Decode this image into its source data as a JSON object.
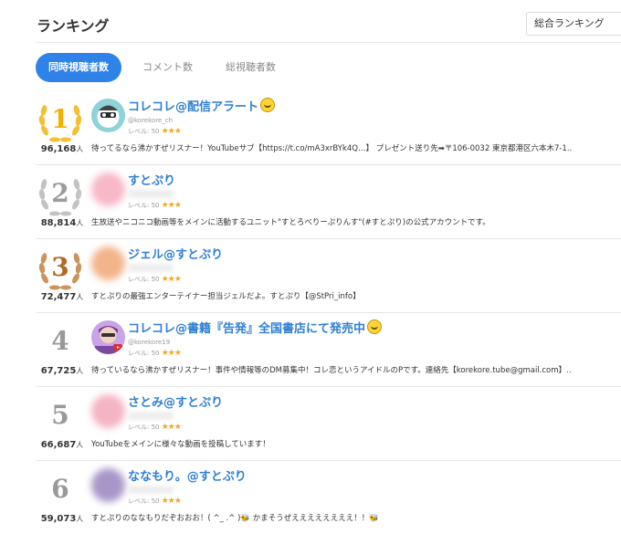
{
  "page": {
    "title": "ランキング"
  },
  "select": {
    "value": "総合ランキング"
  },
  "tabs": [
    {
      "label": "同時視聴者数",
      "active": true
    },
    {
      "label": "コメント数",
      "active": false
    },
    {
      "label": "総視聴者数",
      "active": false
    }
  ],
  "colors": {
    "accent": "#2e82e8",
    "name": "#2f7fd4",
    "star": "#f5a623",
    "gold": "#f5b000",
    "silver": "#9c9c9c",
    "bronze": "#b06a25"
  },
  "rows": [
    {
      "rank": "1",
      "viewers": "96,168",
      "unit": "人",
      "name": "コレコレ@配信アラート",
      "handle": "@korekore_ch",
      "level_label": "レベル: 50",
      "stars": "★★★",
      "desc": "待ってるなら沸かすぜリスナー！YouTubeサブ【https://t.co/mA3xrBYk4Q…】 プレゼント送り先➡〒106-0032 東京都港区六本木7-1.."
    },
    {
      "rank": "2",
      "viewers": "88,814",
      "unit": "人",
      "name": "すとぷり",
      "handle": "",
      "level_label": "レベル: 50",
      "stars": "★★★",
      "desc": "生放送やニコニコ動画等をメインに活動するユニット\"すとろべりーぷりんす\"(#すとぷり)の公式アカウントです。"
    },
    {
      "rank": "3",
      "viewers": "72,477",
      "unit": "人",
      "name": "ジェル@すとぷり",
      "handle": "",
      "level_label": "レベル: 50",
      "stars": "★★★",
      "desc": "すとぷりの最強エンターテイナー担当ジェルだよ。すとぷり【@StPri_info】"
    },
    {
      "rank": "4",
      "viewers": "67,725",
      "unit": "人",
      "name": "コレコレ@書籍『告発』全国書店にて発売中",
      "handle": "@korekore19",
      "level_label": "レベル: 50",
      "stars": "★★★",
      "desc": "待っているなら沸かすぜリスナー！事件や情報等のDM募集中！コレ恋というアイドルのPです。連絡先【korekore.tube@gmail.com】.."
    },
    {
      "rank": "5",
      "viewers": "66,687",
      "unit": "人",
      "name": "さとみ@すとぷり",
      "handle": "",
      "level_label": "レベル: 50",
      "stars": "★★★",
      "desc": "YouTubeをメインに様々な動画を投稿しています！"
    },
    {
      "rank": "6",
      "viewers": "59,073",
      "unit": "人",
      "name": "ななもり。@すとぷり",
      "handle": "",
      "level_label": "レベル: 50",
      "stars": "★★★",
      "desc": "すとぷりのななもりだぞおおお！( ^_ .^ )🐝 かまそうぜええええええええ！！🐝"
    }
  ]
}
